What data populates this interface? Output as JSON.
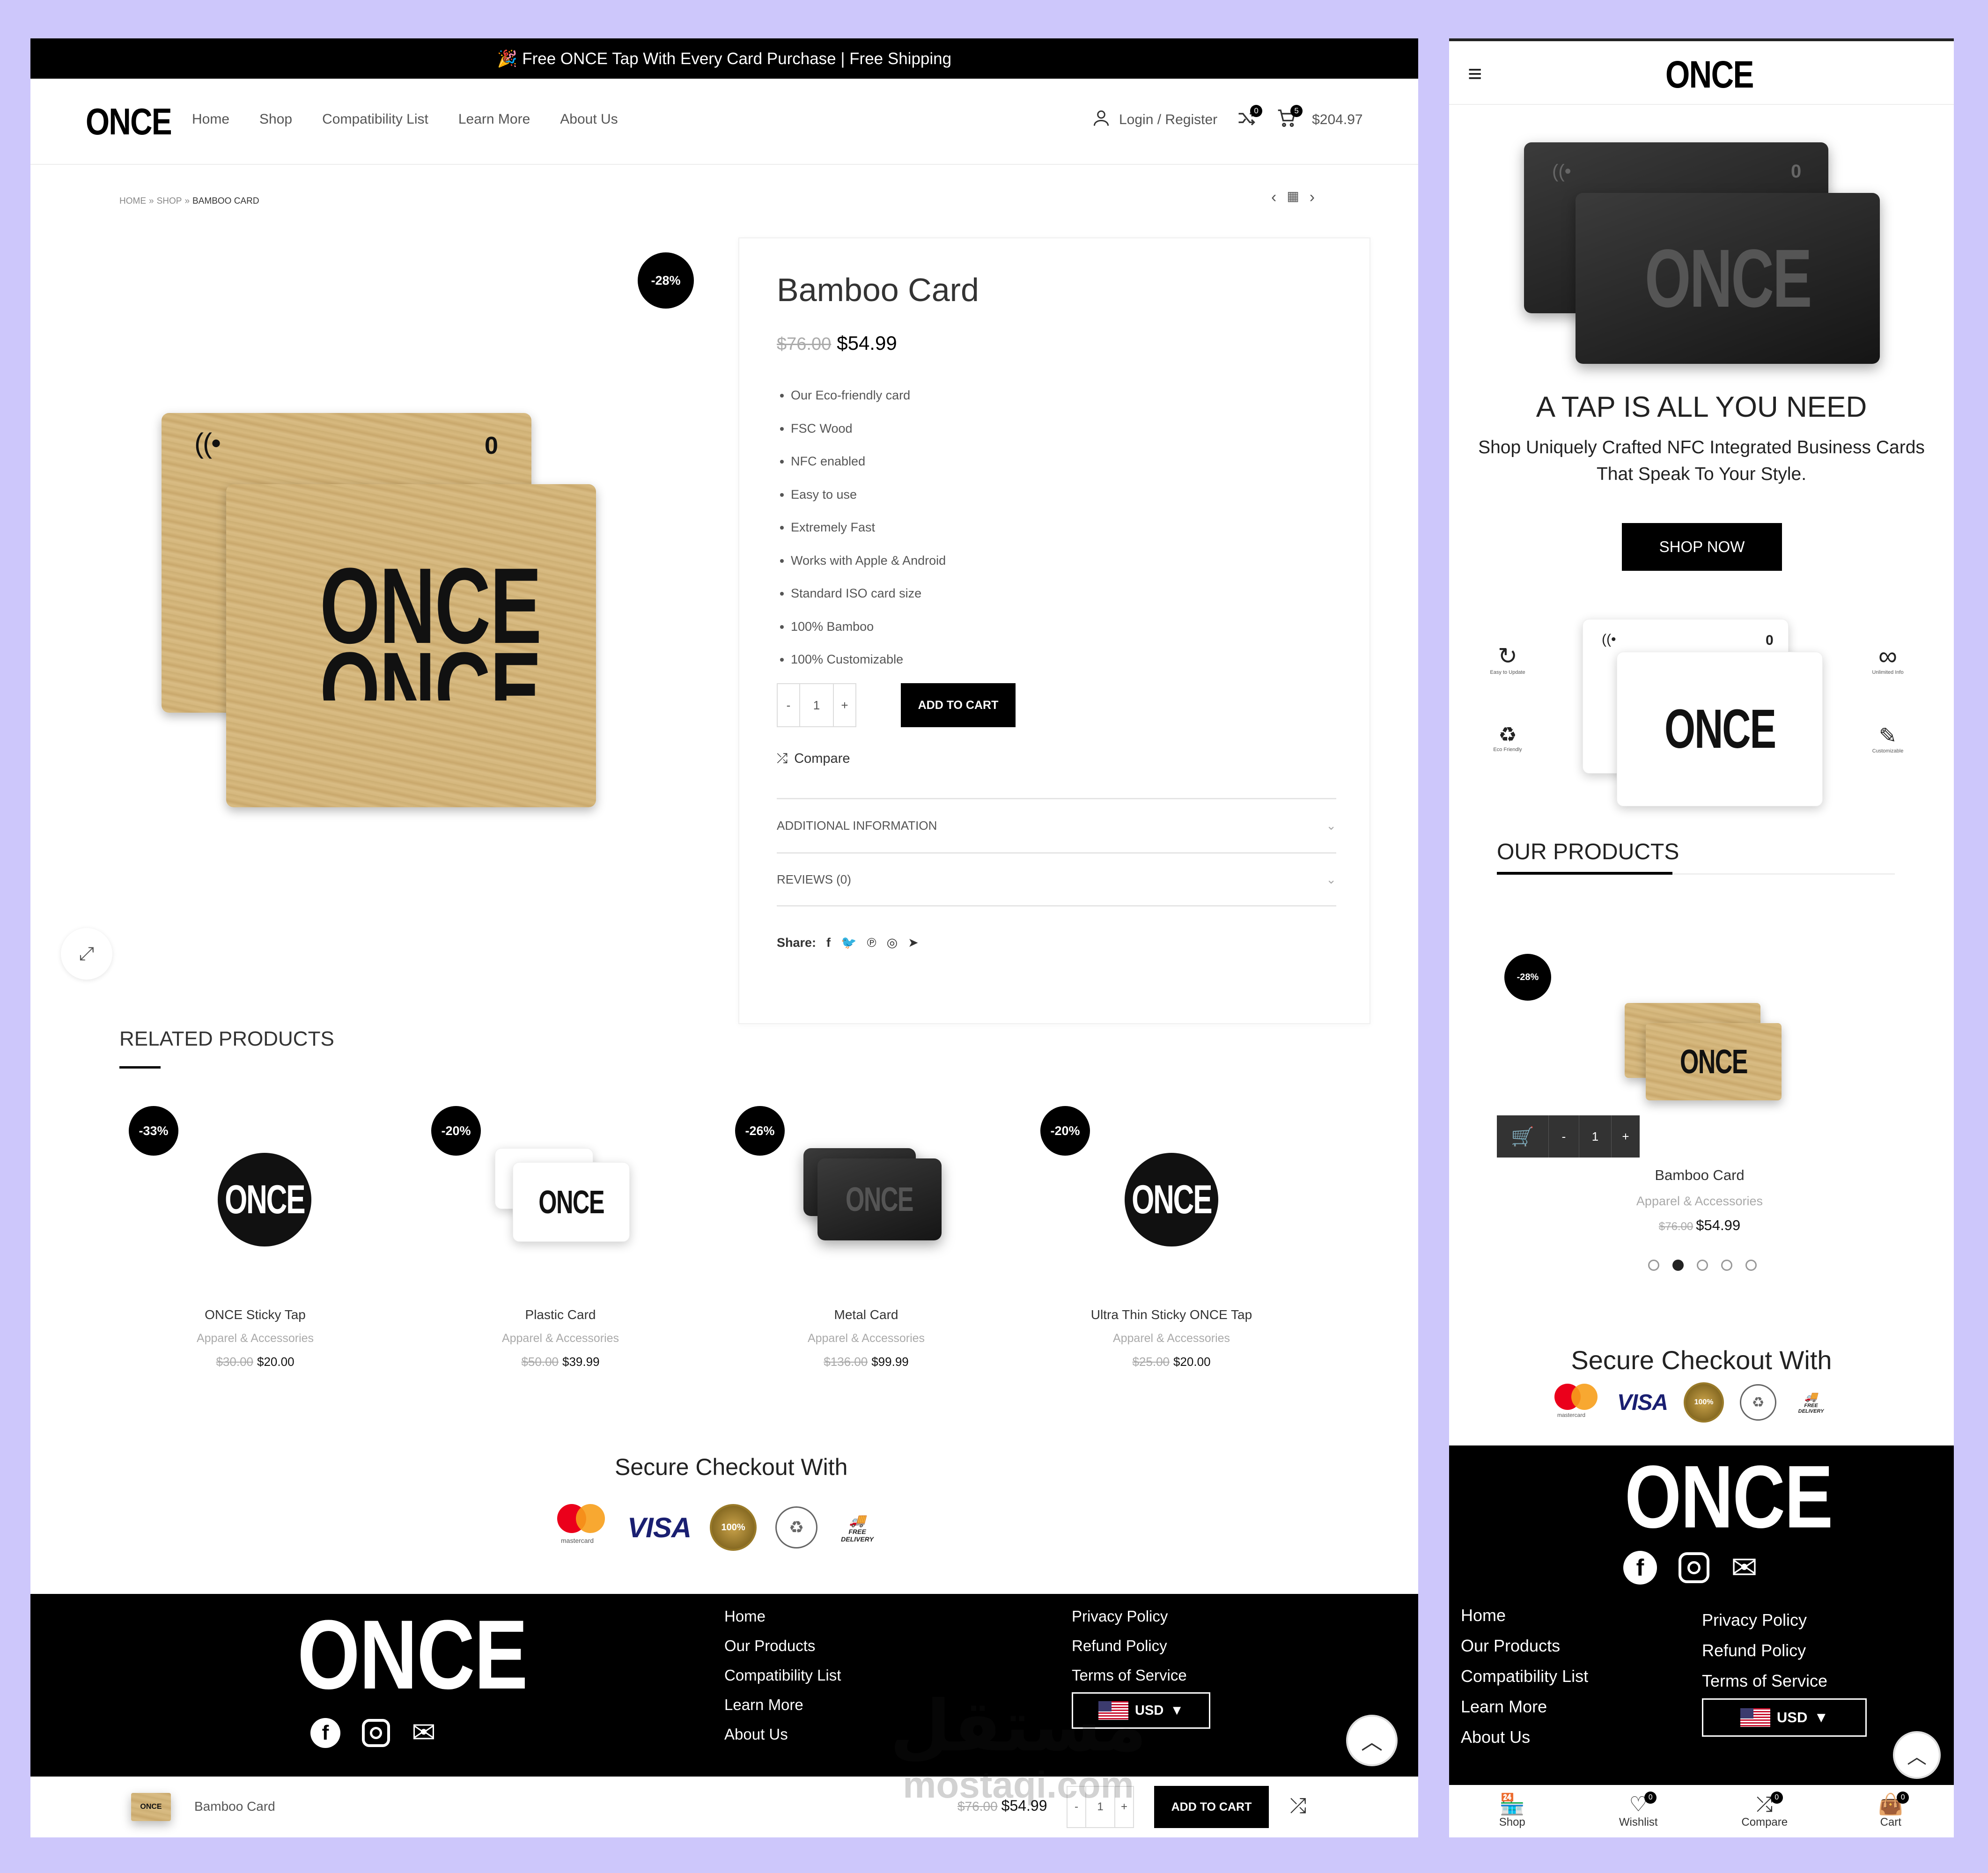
{
  "announcement": "🎉 Free ONCE Tap With Every Card Purchase | Free Shipping",
  "brand": "ONCE",
  "nav": [
    "Home",
    "Shop",
    "Compatibility List",
    "Learn More",
    "About Us"
  ],
  "header": {
    "login": "Login / Register",
    "compare_count": "0",
    "cart_count": "5",
    "cart_total": "$204.97"
  },
  "breadcrumb": {
    "home": "HOME",
    "sep": "»",
    "shop": "SHOP",
    "current": "BAMBOO CARD"
  },
  "product": {
    "badge": "-28%",
    "title": "Bamboo Card",
    "old_price": "$76.00",
    "price": "$54.99",
    "features": [
      "Our Eco-friendly card",
      "FSC Wood",
      "NFC enabled",
      "Easy to use",
      "Extremely Fast",
      "Works with Apple & Android",
      "Standard ISO card size",
      "100% Bamboo",
      "100% Customizable"
    ],
    "qty": "1",
    "minus": "-",
    "plus": "+",
    "add_to_cart": "ADD TO CART",
    "compare": "Compare",
    "accordion": [
      "ADDITIONAL INFORMATION",
      "REVIEWS (0)"
    ],
    "share_label": "Share:",
    "card_text": "ONCE",
    "card_zero": "0"
  },
  "related": {
    "title": "RELATED PRODUCTS",
    "items": [
      {
        "badge": "-33%",
        "name": "ONCE Sticky Tap",
        "category": "Apparel & Accessories",
        "old_price": "$30.00",
        "price": "$20.00"
      },
      {
        "badge": "-20%",
        "name": "Plastic Card",
        "category": "Apparel & Accessories",
        "old_price": "$50.00",
        "price": "$39.99"
      },
      {
        "badge": "-26%",
        "name": "Metal Card",
        "category": "Apparel & Accessories",
        "old_price": "$136.00",
        "price": "$99.99"
      },
      {
        "badge": "-20%",
        "name": "Ultra Thin Sticky ONCE Tap",
        "category": "Apparel & Accessories",
        "old_price": "$25.00",
        "price": "$20.00"
      }
    ]
  },
  "checkout": {
    "title": "Secure Checkout With",
    "mastercard": "mastercard",
    "visa": "VISA",
    "seal": "100%",
    "free_delivery": "FREE DELIVERY"
  },
  "footer": {
    "col1": [
      "Home",
      "Our Products",
      "Compatibility List",
      "Learn More",
      "About Us"
    ],
    "col2": [
      "Privacy Policy",
      "Refund Policy",
      "Terms of Service"
    ],
    "currency": "USD"
  },
  "sticky": {
    "name": "Bamboo Card",
    "old_price": "$76.00",
    "price": "$54.99",
    "qty": "1",
    "button": "ADD TO CART"
  },
  "watermark": {
    "arabic": "مستقل",
    "latin": "mostaqi.com"
  },
  "mobile": {
    "hero_title": "A TAP IS ALL YOU NEED",
    "hero_sub1": "Shop Uniquely Crafted NFC Integrated Business Cards",
    "hero_sub2": "That Speak To Your Style.",
    "shop_now": "SHOP NOW",
    "features": [
      "Easy to Update",
      "Unlimited Info",
      "Eco Friendly",
      "Customizable"
    ],
    "our_products": "OUR PRODUCTS",
    "product": {
      "badge": "-28%",
      "name": "Bamboo Card",
      "category": "Apparel & Accessories",
      "old_price": "$76.00",
      "price": "$54.99",
      "qty": "1"
    },
    "bottom_nav": [
      {
        "label": "Shop",
        "count": ""
      },
      {
        "label": "Wishlist",
        "count": "0"
      },
      {
        "label": "Compare",
        "count": "0"
      },
      {
        "label": "Cart",
        "count": "0"
      }
    ]
  },
  "colors": {
    "background": "#cdc7fb",
    "black": "#000000",
    "accent": "#000000"
  }
}
